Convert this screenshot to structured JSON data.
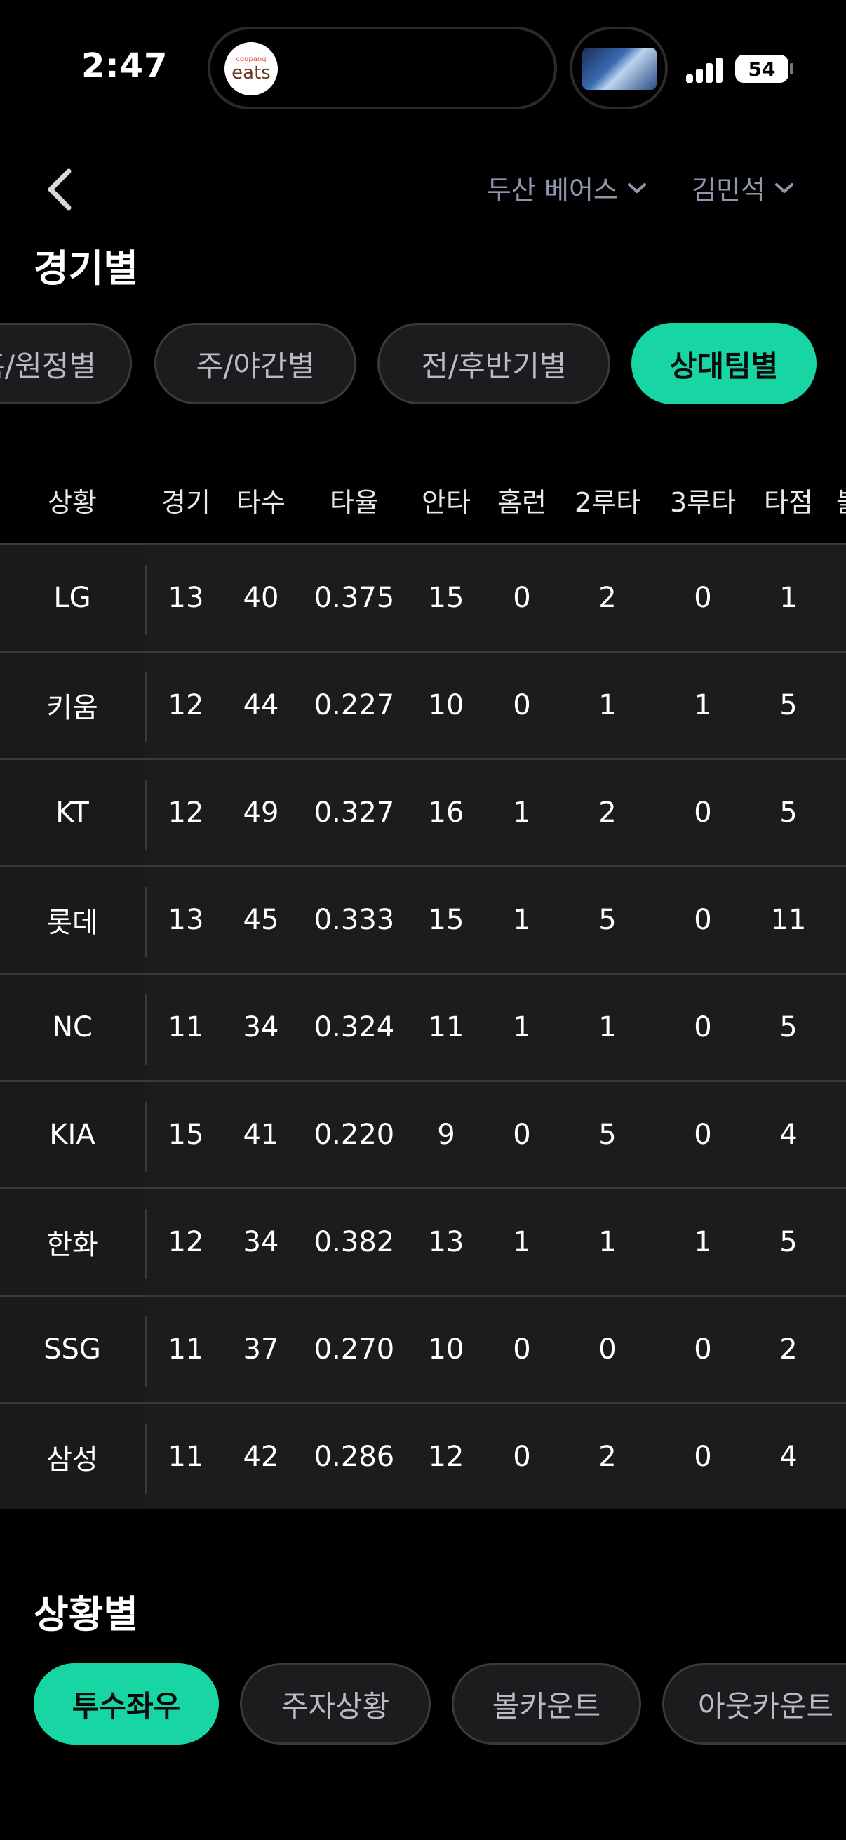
{
  "status_bar": {
    "time": "2:47",
    "battery": "54",
    "app_badge_small": "coupang",
    "app_badge_big": "eats"
  },
  "header": {
    "team": "두산 베어스",
    "player": "김민석"
  },
  "section_game": {
    "title": "경기별",
    "chips": [
      {
        "label": "홈/원정별",
        "active": false
      },
      {
        "label": "주/야간별",
        "active": false
      },
      {
        "label": "전/후반기별",
        "active": false
      },
      {
        "label": "상대팀별",
        "active": true
      }
    ]
  },
  "table": {
    "columns": [
      "상황",
      "경기",
      "타수",
      "타율",
      "안타",
      "홈런",
      "2루타",
      "3루타",
      "타점",
      "볼"
    ],
    "rows": [
      [
        "LG",
        "13",
        "40",
        "0.375",
        "15",
        "0",
        "2",
        "0",
        "1"
      ],
      [
        "키움",
        "12",
        "44",
        "0.227",
        "10",
        "0",
        "1",
        "1",
        "5"
      ],
      [
        "KT",
        "12",
        "49",
        "0.327",
        "16",
        "1",
        "2",
        "0",
        "5"
      ],
      [
        "롯데",
        "13",
        "45",
        "0.333",
        "15",
        "1",
        "5",
        "0",
        "11"
      ],
      [
        "NC",
        "11",
        "34",
        "0.324",
        "11",
        "1",
        "1",
        "0",
        "5"
      ],
      [
        "KIA",
        "15",
        "41",
        "0.220",
        "9",
        "0",
        "5",
        "0",
        "4"
      ],
      [
        "한화",
        "12",
        "34",
        "0.382",
        "13",
        "1",
        "1",
        "1",
        "5"
      ],
      [
        "SSG",
        "11",
        "37",
        "0.270",
        "10",
        "0",
        "0",
        "0",
        "2"
      ],
      [
        "삼성",
        "11",
        "42",
        "0.286",
        "12",
        "0",
        "2",
        "0",
        "4"
      ]
    ]
  },
  "section_situation": {
    "title": "상황별",
    "chips": [
      {
        "label": "투수좌우",
        "active": true
      },
      {
        "label": "주자상황",
        "active": false
      },
      {
        "label": "볼카운트",
        "active": false
      },
      {
        "label": "아웃카운트",
        "active": false
      }
    ]
  },
  "colors": {
    "accent": "#17d6a3",
    "background": "#000000",
    "table_bg": "#1c1c1e",
    "muted_text": "#8f97aa"
  }
}
